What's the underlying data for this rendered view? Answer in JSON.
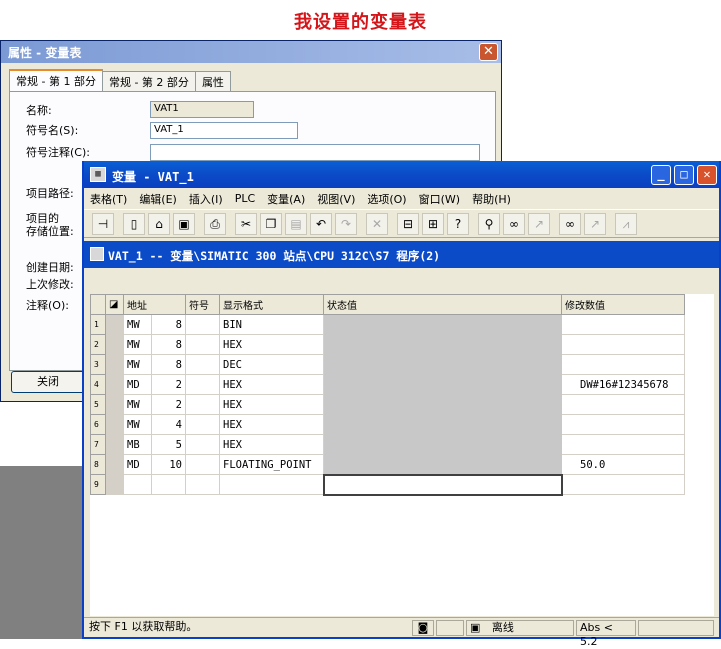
{
  "caption": "我设置的变量表",
  "props": {
    "title": "属性 - 变量表",
    "tabs": [
      "常规 - 第 1 部分",
      "常规 - 第 2 部分",
      "属性"
    ],
    "fields": [
      {
        "label": "名称:",
        "value": "VAT1"
      },
      {
        "label": "符号名(S):",
        "value": "VAT_1"
      },
      {
        "label": "符号注释(C):",
        "value": ""
      },
      {
        "label": "项目路径:",
        "value": ""
      },
      {
        "label": "项目的\n存储位置:",
        "value": ""
      },
      {
        "label": "创建日期:",
        "value": ""
      },
      {
        "label": "上次修改:",
        "value": ""
      },
      {
        "label": "注释(O):",
        "value": ""
      }
    ],
    "close_label": "关闭"
  },
  "vat": {
    "title": "变量 - VAT_1",
    "menu": [
      "表格(T)",
      "编辑(E)",
      "插入(I)",
      "PLC",
      "变量(A)",
      "视图(V)",
      "选项(O)",
      "窗口(W)",
      "帮助(H)"
    ],
    "toolbar_icons": [
      "pin-icon",
      "new-icon",
      "open-icon",
      "save-icon",
      "print-icon",
      "cut-icon",
      "copy-icon",
      "paste-icon",
      "undo-icon",
      "redo-icon",
      "delete-icon",
      "online-icon",
      "accessible-node-icon",
      "help-icon",
      "monitor-icon",
      "monitor-glasses-icon",
      "modify-icon",
      "read-icon",
      "modify-now-icon",
      "activate-values-icon"
    ],
    "inner_title": "VAT_1 -- 变量\\SIMATIC 300 站点\\CPU 312C\\S7 程序(2)",
    "headers": [
      "地址",
      "符号",
      "显示格式",
      "状态值",
      "修改数值"
    ],
    "rows": [
      {
        "n": "1",
        "type": "MW",
        "addr": "8",
        "fmt": "BIN",
        "modify": ""
      },
      {
        "n": "2",
        "type": "MW",
        "addr": "8",
        "fmt": "HEX",
        "modify": ""
      },
      {
        "n": "3",
        "type": "MW",
        "addr": "8",
        "fmt": "DEC",
        "modify": ""
      },
      {
        "n": "4",
        "type": "MD",
        "addr": "2",
        "fmt": "HEX",
        "modify": "DW#16#12345678"
      },
      {
        "n": "5",
        "type": "MW",
        "addr": "2",
        "fmt": "HEX",
        "modify": ""
      },
      {
        "n": "6",
        "type": "MW",
        "addr": "4",
        "fmt": "HEX",
        "modify": ""
      },
      {
        "n": "7",
        "type": "MB",
        "addr": "5",
        "fmt": "HEX",
        "modify": ""
      },
      {
        "n": "8",
        "type": "MD",
        "addr": "10",
        "fmt": "FLOATING_POINT",
        "modify": "50.0"
      },
      {
        "n": "9",
        "type": "",
        "addr": "",
        "fmt": "",
        "modify": ""
      }
    ],
    "status": {
      "help": "按下 F1 以获取帮助。",
      "mode": "离线",
      "abs": "Abs < 5.2"
    }
  }
}
